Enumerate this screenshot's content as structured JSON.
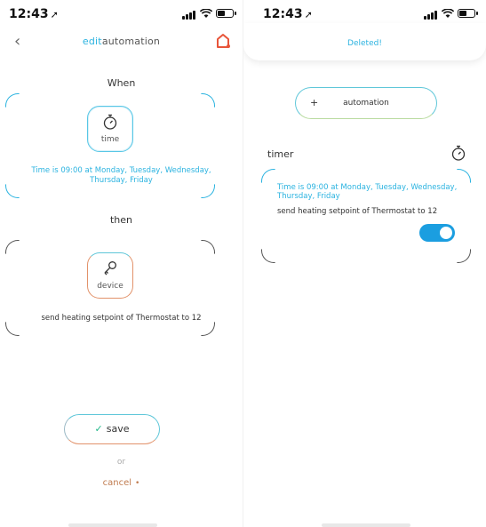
{
  "status_bar": {
    "time": "12:43"
  },
  "left": {
    "header": {
      "title_prefix": "edit",
      "title_suffix": "automation"
    },
    "when_label": "When",
    "trigger": {
      "label": "time",
      "condition": "Time is 09:00 at Monday, Tuesday, Wednesday, Thursday, Friday"
    },
    "then_label": "then",
    "action": {
      "label": "device",
      "description": "send heating setpoint of  Thermostat  to 12"
    },
    "save_label": "save",
    "or_label": "or",
    "cancel_label": "cancel"
  },
  "right": {
    "toast": "Deleted!",
    "add_button": {
      "plus": "+",
      "label": "automation"
    },
    "timer_heading": "timer",
    "card": {
      "condition": "Time is 09:00 at Monday, Tuesday, Wednesday, Thursday, Friday",
      "action": "send heating setpoint of  Thermostat  to 12",
      "enabled": true
    }
  },
  "colors": {
    "accent_blue": "#2bb3e0",
    "accent_orange": "#e2926a",
    "toggle_on": "#1b9ee0",
    "home_icon": "#e8553a"
  },
  "icons": [
    "location-arrow-icon",
    "signal-icon",
    "wifi-icon",
    "battery-icon",
    "back-chevron-icon",
    "home-icon",
    "stopwatch-icon",
    "key-icon",
    "check-icon"
  ]
}
